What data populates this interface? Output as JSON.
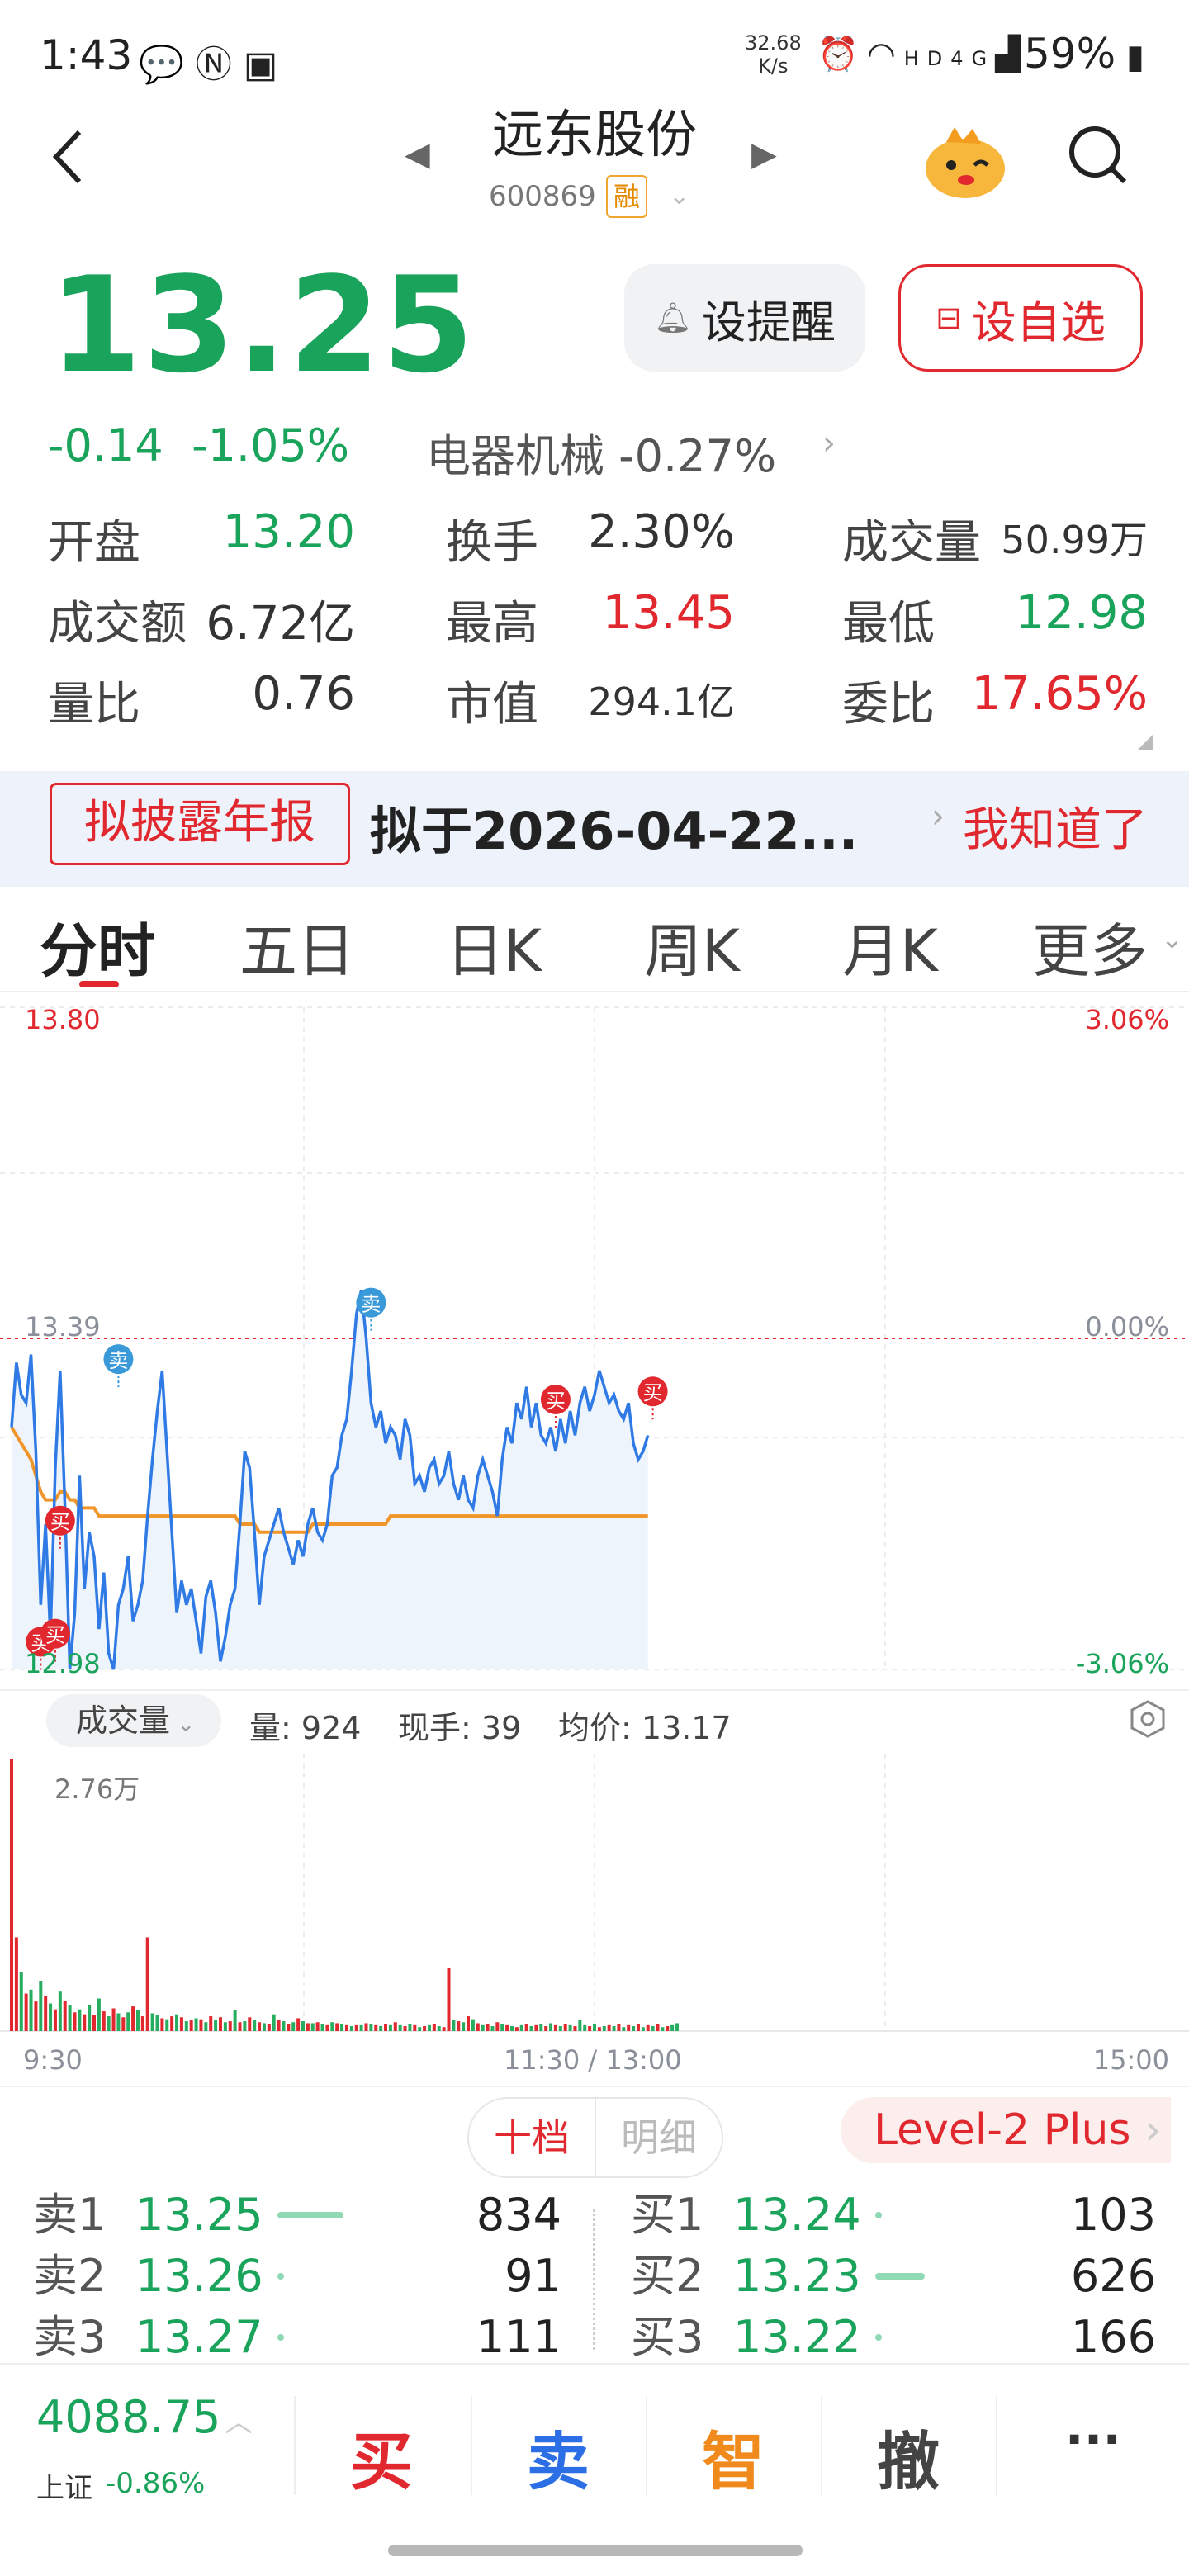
{
  "status_bar": {
    "time": "1:43",
    "net_speed_value": "32.68",
    "net_speed_unit": "K/s",
    "signal": "HD",
    "network": "4G",
    "battery": "59%"
  },
  "header": {
    "stock_name": "远东股份",
    "stock_code": "600869",
    "margin_badge": "融"
  },
  "quote": {
    "price": "13.25",
    "change": "-0.14",
    "change_pct": "-1.05%",
    "sector": "电器机械 -0.27%",
    "alert_button": "设提醒",
    "watch_button": "设自选"
  },
  "stats": [
    {
      "label": "开盘",
      "value": "13.20",
      "color": "#1aa35a"
    },
    {
      "label": "换手",
      "value": "2.30%",
      "color": "#333333"
    },
    {
      "label": "成交量",
      "value": "50.99万",
      "color": "#333333"
    },
    {
      "label": "成交额",
      "value": "6.72亿",
      "color": "#333333"
    },
    {
      "label": "最高",
      "value": "13.45",
      "color": "#e0282e"
    },
    {
      "label": "最低",
      "value": "12.98",
      "color": "#1aa35a"
    },
    {
      "label": "量比",
      "value": "0.76",
      "color": "#333333"
    },
    {
      "label": "市值",
      "value": "294.1亿",
      "color": "#333333"
    },
    {
      "label": "委比",
      "value": "17.65%",
      "color": "#e0282e"
    }
  ],
  "banner": {
    "tag": "拟披露年报",
    "text": "拟于2026-04-22...",
    "link": "我知道了"
  },
  "tabs": [
    "分时",
    "五日",
    "日K",
    "周K",
    "月K",
    "更多"
  ],
  "chart_labels": {
    "price_high": "13.80",
    "price_mid": "13.39",
    "price_low": "12.98",
    "pct_high": "3.06%",
    "pct_mid": "0.00%",
    "pct_low": "-3.06%",
    "vol_max": "2.76万",
    "time_start": "9:30",
    "time_mid": "11:30 / 13:00",
    "time_end": "15:00"
  },
  "chart_markers": {
    "buy": "买",
    "sell": "卖"
  },
  "chart_data": {
    "type": "line",
    "series": [
      {
        "values": [
          13.28,
          13.36,
          13.32,
          13.31,
          13.37,
          13.25,
          13.06,
          13.16,
          13.02,
          13.23,
          13.35,
          13.18,
          12.98,
          13.05,
          13.22,
          13.08,
          13.15,
          13.12,
          13.03,
          13.1,
          13.0,
          12.98,
          13.06,
          13.08,
          13.12,
          13.04,
          13.06,
          13.09,
          13.17,
          13.24,
          13.3,
          13.35,
          13.25,
          13.15,
          13.05,
          13.09,
          13.06,
          13.08,
          13.04,
          13.0,
          13.07,
          13.09,
          13.05,
          12.99,
          13.02,
          13.06,
          13.08,
          13.16,
          13.25,
          13.23,
          13.15,
          13.06,
          13.12,
          13.14,
          13.16,
          13.18,
          13.15,
          13.13,
          13.11,
          13.14,
          13.12,
          13.16,
          13.18,
          13.15,
          13.14,
          13.16,
          13.22,
          13.23,
          13.27,
          13.29,
          13.35,
          13.42,
          13.45,
          13.39,
          13.31,
          13.28,
          13.3,
          13.26,
          13.28,
          13.27,
          13.24,
          13.29,
          13.27,
          13.21,
          13.22,
          13.2,
          13.23,
          13.24,
          13.21,
          13.22,
          13.25,
          13.21,
          13.19,
          13.22,
          13.19,
          13.18,
          13.22,
          13.24,
          13.22,
          13.2,
          13.17,
          13.24,
          13.28,
          13.26,
          13.31,
          13.29,
          13.33,
          13.28,
          13.31,
          13.27,
          13.26,
          13.28,
          13.25,
          13.29,
          13.26,
          13.3,
          13.27,
          13.31,
          13.33,
          13.3,
          13.32,
          13.35,
          13.33,
          13.31,
          13.32,
          13.3,
          13.29,
          13.31,
          13.26,
          13.24,
          13.25,
          13.27
        ]
      },
      {
        "values": [
          13.28,
          13.27,
          13.26,
          13.25,
          13.24,
          13.22,
          13.2,
          13.19,
          13.19,
          13.19,
          13.2,
          13.2,
          13.19,
          13.19,
          13.18,
          13.18,
          13.18,
          13.18,
          13.17,
          13.17,
          13.17,
          13.17,
          13.17,
          13.17,
          13.17,
          13.17,
          13.17,
          13.17,
          13.17,
          13.17,
          13.17,
          13.17,
          13.17,
          13.17,
          13.17,
          13.17,
          13.17,
          13.17,
          13.17,
          13.17,
          13.17,
          13.17,
          13.17,
          13.17,
          13.17,
          13.17,
          13.17,
          13.16,
          13.16,
          13.16,
          13.16,
          13.15,
          13.15,
          13.15,
          13.15,
          13.15,
          13.15,
          13.15,
          13.15,
          13.15,
          13.15,
          13.15,
          13.16,
          13.16,
          13.16,
          13.16,
          13.16,
          13.16,
          13.16,
          13.16,
          13.16,
          13.16,
          13.16,
          13.16,
          13.16,
          13.16,
          13.16,
          13.16,
          13.17,
          13.17,
          13.17,
          13.17,
          13.17,
          13.17,
          13.17,
          13.17,
          13.17,
          13.17,
          13.17,
          13.17,
          13.17,
          13.17,
          13.17,
          13.17,
          13.17,
          13.17,
          13.17,
          13.17,
          13.17,
          13.17,
          13.17,
          13.17,
          13.17,
          13.17,
          13.17,
          13.17,
          13.17,
          13.17,
          13.17,
          13.17,
          13.17,
          13.17,
          13.17,
          13.17,
          13.17,
          13.17,
          13.17,
          13.17,
          13.17,
          13.17,
          13.17,
          13.17,
          13.17,
          13.17,
          13.17,
          13.17,
          13.17,
          13.17,
          13.17,
          13.17,
          13.17,
          13.17
        ]
      }
    ],
    "ylim": [
      12.98,
      13.8
    ],
    "prev_close": 13.39,
    "markers": [
      {
        "type": "sell",
        "i": 22,
        "v": 13.35
      },
      {
        "type": "buy",
        "i": 10,
        "v": 13.15
      },
      {
        "type": "buy",
        "i": 6,
        "v": 13.0
      },
      {
        "type": "buy",
        "i": 9,
        "v": 13.01
      },
      {
        "type": "sell",
        "i": 74,
        "v": 13.42
      },
      {
        "type": "buy",
        "i": 112,
        "v": 13.3
      },
      {
        "type": "buy",
        "i": 132,
        "v": 13.31
      }
    ],
    "volumes": [
      27600,
      9500,
      6000,
      3800,
      4200,
      3000,
      5100,
      3600,
      2800,
      2200,
      4000,
      3100,
      2600,
      1900,
      2200,
      1700,
      2600,
      1600,
      3300,
      2000,
      1500,
      2300,
      1800,
      1400,
      1900,
      2500,
      2100,
      1500,
      9500,
      1800,
      1600,
      1300,
      1200,
      1500,
      1700,
      1400,
      1000,
      1100,
      1300,
      1200,
      900,
      1500,
      1100,
      1400,
      900,
      1000,
      2100,
      900,
      1000,
      1400,
      1100,
      900,
      800,
      700,
      1700,
      1100,
      1000,
      700,
      900,
      1300,
      1000,
      800,
      800,
      900,
      700,
      600,
      900,
      800,
      700,
      600,
      500,
      600,
      600,
      800,
      700,
      600,
      500,
      700,
      600,
      900,
      600,
      500,
      700,
      600,
      400,
      500,
      600,
      700,
      500,
      400,
      6400,
      1100,
      1000,
      900,
      1500,
      1200,
      800,
      600,
      700,
      500,
      900,
      700,
      600,
      500,
      400,
      600,
      700,
      500,
      600,
      700,
      500,
      800,
      600,
      500,
      700,
      600,
      500,
      1100,
      600,
      500,
      700,
      400,
      500,
      600,
      500,
      700,
      400,
      600,
      500,
      700,
      400,
      600,
      500,
      700,
      400,
      500,
      600,
      800
    ],
    "volume_colors": [
      "r",
      "r",
      "g",
      "r",
      "g",
      "r",
      "g",
      "r",
      "g",
      "r",
      "g",
      "r",
      "g",
      "r",
      "g",
      "r",
      "g",
      "r",
      "g",
      "r",
      "g",
      "r",
      "g",
      "r",
      "g",
      "r",
      "g",
      "r",
      "r",
      "g",
      "g",
      "r",
      "g",
      "r",
      "g",
      "r",
      "g",
      "r",
      "g",
      "r",
      "g",
      "r",
      "g",
      "r",
      "g",
      "r",
      "g",
      "r",
      "g",
      "r",
      "g",
      "r",
      "g",
      "r",
      "g",
      "r",
      "g",
      "r",
      "g",
      "r",
      "g",
      "r",
      "g",
      "r",
      "g",
      "r",
      "g",
      "r",
      "g",
      "r",
      "g",
      "r",
      "g",
      "r",
      "g",
      "r",
      "g",
      "r",
      "g",
      "r",
      "g",
      "r",
      "g",
      "r",
      "g",
      "r",
      "g",
      "r",
      "g",
      "r",
      "r",
      "g",
      "r",
      "g",
      "r",
      "g",
      "r",
      "g",
      "r",
      "g",
      "r",
      "g",
      "r",
      "g",
      "r",
      "g",
      "r",
      "g",
      "r",
      "g",
      "r",
      "g",
      "r",
      "g",
      "r",
      "g",
      "r",
      "g",
      "g",
      "r",
      "g",
      "r",
      "g",
      "r",
      "g",
      "r",
      "g",
      "r",
      "g",
      "r",
      "g",
      "r",
      "g",
      "r",
      "g",
      "r"
    ],
    "vol_ylim": [
      0,
      27600
    ],
    "current_volume": {
      "label_vol": "量:",
      "vol": "924",
      "label_hand": "现手:",
      "hand": "39",
      "label_avg": "均价:",
      "avg": "13.17"
    }
  },
  "volume_panel": {
    "selector": "成交量"
  },
  "order_book": {
    "tab_active": "十档",
    "tab_other": "明细",
    "level2": "Level-2 Plus",
    "sell": [
      {
        "label": "卖1",
        "price": "13.25",
        "qty": "834",
        "bar": 0.8
      },
      {
        "label": "卖2",
        "price": "13.26",
        "qty": "91",
        "bar": 0.04
      },
      {
        "label": "卖3",
        "price": "13.27",
        "qty": "111",
        "bar": 0.04
      }
    ],
    "buy": [
      {
        "label": "买1",
        "price": "13.24",
        "qty": "103",
        "bar": 0.04
      },
      {
        "label": "买2",
        "price": "13.23",
        "qty": "626",
        "bar": 0.6
      },
      {
        "label": "买3",
        "price": "13.22",
        "qty": "166",
        "bar": 0.04
      }
    ]
  },
  "bottom_bar": {
    "index_value": "4088.75",
    "index_name": "上证",
    "index_change": "-0.86%",
    "buy": "买",
    "sell": "卖",
    "smart": "智",
    "cancel": "撤",
    "more": "···"
  }
}
